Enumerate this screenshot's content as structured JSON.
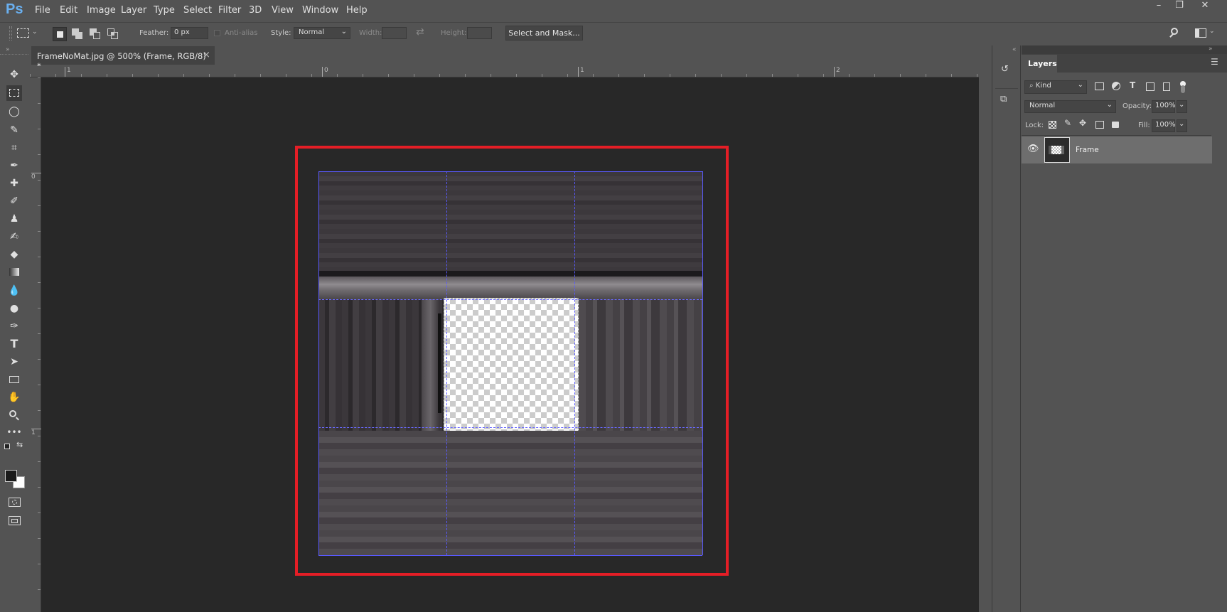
{
  "app": {
    "logo": "Ps"
  },
  "menu": [
    "File",
    "Edit",
    "Image",
    "Layer",
    "Type",
    "Select",
    "Filter",
    "3D",
    "View",
    "Window",
    "Help"
  ],
  "window_buttons": [
    "–",
    "❐",
    "✕"
  ],
  "options": {
    "feather_label": "Feather:",
    "feather_value": "0 px",
    "antialias_label": "Anti-alias",
    "style_label": "Style:",
    "style_value": "Normal",
    "width_label": "Width:",
    "height_label": "Height:",
    "select_mask_label": "Select and Mask..."
  },
  "document": {
    "tab_title": "FrameNoMat.jpg @ 500% (Frame, RGB/8) *",
    "close_glyph": "×"
  },
  "rulers": {
    "top": [
      "1",
      "0",
      "1",
      "2"
    ],
    "left": [
      "0",
      "1"
    ]
  },
  "layers": {
    "tab_label": "Layers",
    "kind_label": "Kind",
    "blend_mode": "Normal",
    "opacity_label": "Opacity:",
    "opacity_value": "100%",
    "lock_label": "Lock:",
    "fill_label": "Fill:",
    "fill_value": "100%",
    "items": [
      {
        "name": "Frame",
        "visible": true,
        "selected": true
      }
    ]
  },
  "colors": {
    "highlight": "#e41e26",
    "guide": "#5a5aff"
  }
}
